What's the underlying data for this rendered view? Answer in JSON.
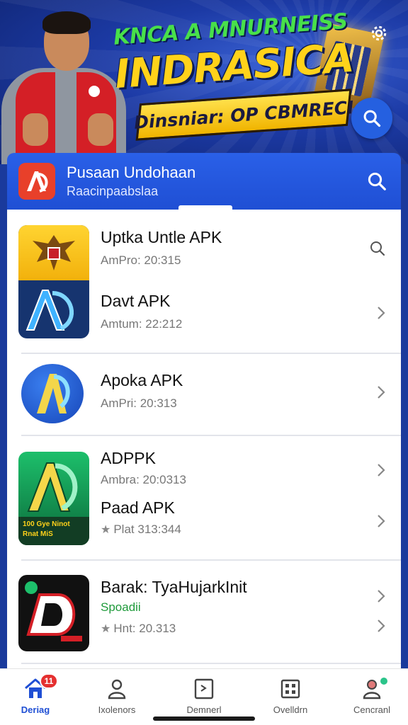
{
  "banner": {
    "headline_small": "KNCA A MNURNEISS",
    "headline_large": "INDRASICA",
    "ribbon_text": "Dinsniar: OP CBMRECI"
  },
  "header": {
    "title": "Pusaan Undohaan",
    "subtitle": "Raacinpaabslaa"
  },
  "apps": [
    {
      "name": "Uptka Untle APK",
      "meta": "AmPro: 20:315"
    },
    {
      "name": "Davt APK",
      "meta": "Amtum: 22:212"
    },
    {
      "name": "Apoka APK",
      "meta": "AmPri: 20:313"
    },
    {
      "name": "ADPPK",
      "meta": "Ambra: 20:0313"
    },
    {
      "name": "Paad APK",
      "meta": "Plat 313:344"
    },
    {
      "name": "Barak: TyaHujarkInit",
      "meta": "Spoadii"
    },
    {
      "name": "",
      "meta": "Hnt: 20.313"
    }
  ],
  "tile_text": {
    "green_tile": "100 Gye  Ninot Rnat  MiS"
  },
  "nav": [
    {
      "label": "Deriag",
      "badge": "11"
    },
    {
      "label": "Ixolenors"
    },
    {
      "label": "Demnerl"
    },
    {
      "label": "Ovelldrn"
    },
    {
      "label": "Cencranl"
    }
  ],
  "colors": {
    "primary": "#1f4fd4",
    "banner_bg": "#1c3aa5",
    "headline_yellow": "#ffd21a",
    "headline_green": "#48e04a",
    "badge_red": "#e53030",
    "meta_green": "#1e9a3a"
  }
}
